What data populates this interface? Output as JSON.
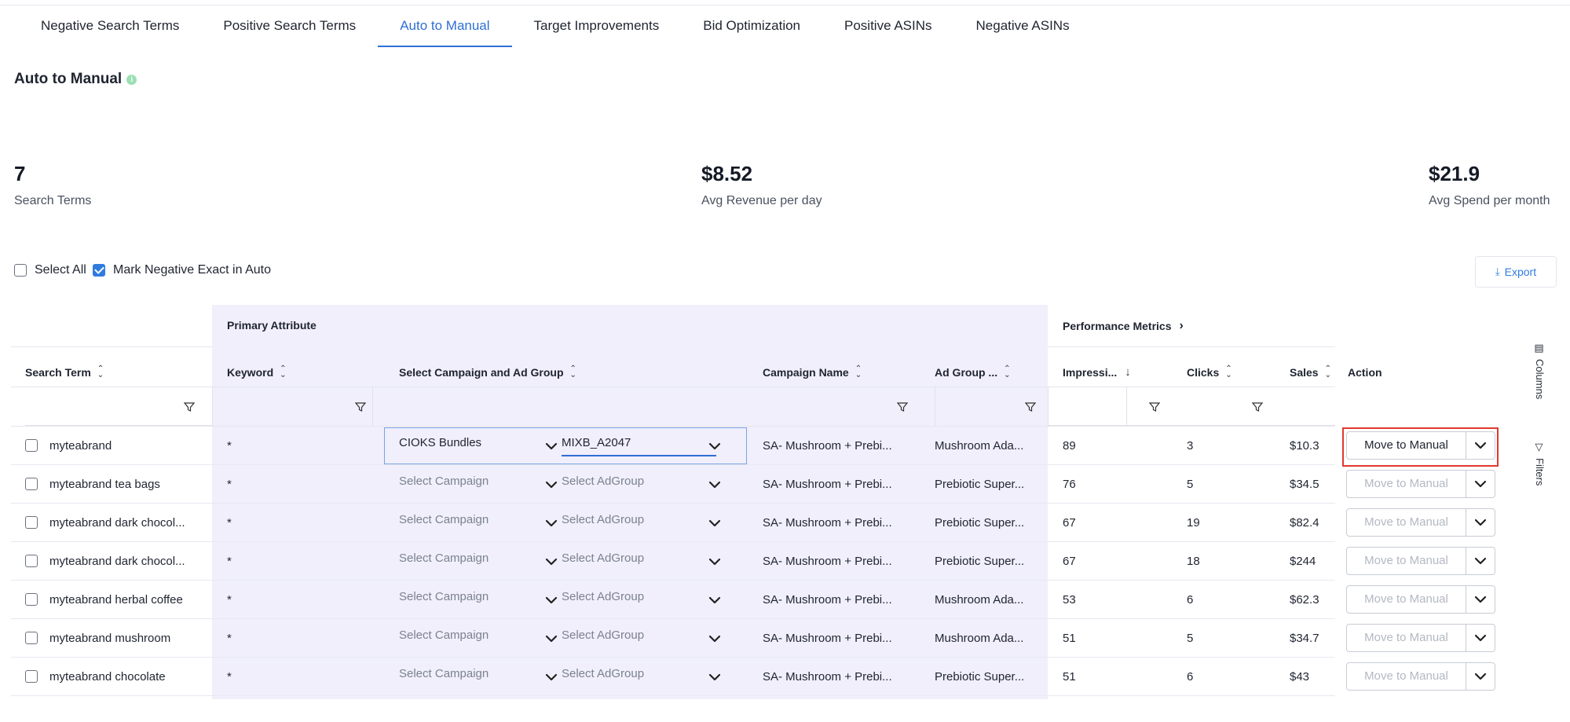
{
  "tabs": [
    {
      "label": "Negative Search Terms",
      "active": false
    },
    {
      "label": "Positive Search Terms",
      "active": false
    },
    {
      "label": "Auto to Manual",
      "active": true
    },
    {
      "label": "Target Improvements",
      "active": false
    },
    {
      "label": "Bid Optimization",
      "active": false
    },
    {
      "label": "Positive ASINs",
      "active": false
    },
    {
      "label": "Negative ASINs",
      "active": false
    }
  ],
  "page": {
    "title": "Auto to Manual",
    "info_icon": "i"
  },
  "metrics": [
    {
      "value": "7",
      "label": "Search Terms"
    },
    {
      "value": "$8.52",
      "label": "Avg Revenue per day"
    },
    {
      "value": "$21.9",
      "label": "Avg Spend per month"
    }
  ],
  "options": {
    "select_all": "Select All",
    "mark_negative": "Mark Negative Exact in Auto",
    "mark_negative_checked": true
  },
  "export_label": "Export",
  "table": {
    "groups": {
      "primary": "Primary Attribute",
      "performance": "Performance Metrics"
    },
    "columns": {
      "search_term": "Search Term",
      "keyword": "Keyword",
      "select_campaign": "Select Campaign and Ad Group",
      "campaign_name": "Campaign Name",
      "ad_group": "Ad Group ...",
      "impressions": "Impressi...",
      "clicks": "Clicks",
      "sales": "Sales",
      "action": "Action"
    },
    "rows": [
      {
        "term": "myteabrand",
        "keyword": "*",
        "campaign": "CIOKS Bundles",
        "adgroup": "MIXB_A2047",
        "campaign_name": "SA- Mushroom + Prebi...",
        "ad_group": "Mushroom Ada...",
        "impressions": "89",
        "clicks": "3",
        "sales": "$10.3",
        "action": "Move to Manual",
        "active": true
      },
      {
        "term": "myteabrand tea bags",
        "keyword": "*",
        "campaign": "Select Campaign",
        "adgroup": "Select AdGroup",
        "campaign_name": "SA- Mushroom + Prebi...",
        "ad_group": "Prebiotic Super...",
        "impressions": "76",
        "clicks": "5",
        "sales": "$34.5",
        "action": "Move to Manual",
        "active": false
      },
      {
        "term": "myteabrand dark chocol...",
        "keyword": "*",
        "campaign": "Select Campaign",
        "adgroup": "Select AdGroup",
        "campaign_name": "SA- Mushroom + Prebi...",
        "ad_group": "Prebiotic Super...",
        "impressions": "67",
        "clicks": "19",
        "sales": "$82.4",
        "action": "Move to Manual",
        "active": false
      },
      {
        "term": "myteabrand dark chocol...",
        "keyword": "*",
        "campaign": "Select Campaign",
        "adgroup": "Select AdGroup",
        "campaign_name": "SA- Mushroom + Prebi...",
        "ad_group": "Prebiotic Super...",
        "impressions": "67",
        "clicks": "18",
        "sales": "$244",
        "action": "Move to Manual",
        "active": false
      },
      {
        "term": "myteabrand herbal coffee",
        "keyword": "*",
        "campaign": "Select Campaign",
        "adgroup": "Select AdGroup",
        "campaign_name": "SA- Mushroom + Prebi...",
        "ad_group": "Mushroom Ada...",
        "impressions": "53",
        "clicks": "6",
        "sales": "$62.3",
        "action": "Move to Manual",
        "active": false
      },
      {
        "term": "myteabrand mushroom",
        "keyword": "*",
        "campaign": "Select Campaign",
        "adgroup": "Select AdGroup",
        "campaign_name": "SA- Mushroom + Prebi...",
        "ad_group": "Mushroom Ada...",
        "impressions": "51",
        "clicks": "5",
        "sales": "$34.7",
        "action": "Move to Manual",
        "active": false
      },
      {
        "term": "myteabrand chocolate",
        "keyword": "*",
        "campaign": "Select Campaign",
        "adgroup": "Select AdGroup",
        "campaign_name": "SA- Mushroom + Prebi...",
        "ad_group": "Prebiotic Super...",
        "impressions": "51",
        "clicks": "6",
        "sales": "$43",
        "action": "Move to Manual",
        "active": false
      }
    ]
  },
  "side": {
    "columns": "Columns",
    "filters": "Filters"
  },
  "colors": {
    "accent": "#2f6fd6",
    "highlight": "#e0392f",
    "purple_bg": "#f0effb"
  }
}
